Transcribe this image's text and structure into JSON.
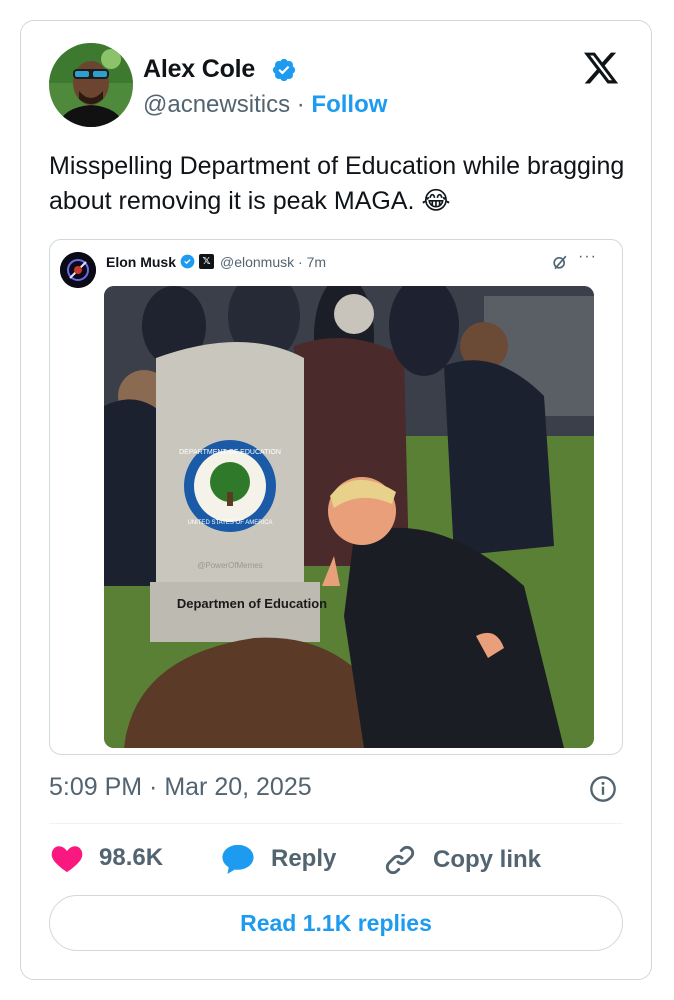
{
  "tweet": {
    "author_name": "Alex Cole",
    "author_handle": "@acnewsitics",
    "separator": "·",
    "follow_label": "Follow",
    "text": "Misspelling Department of Education while bragging about removing it is peak MAGA. 😂",
    "timestamp": "5:09 PM · Mar 20, 2025",
    "likes": "98.6K",
    "reply_label": "Reply",
    "copy_link_label": "Copy link",
    "read_replies_label": "Read 1.1K replies"
  },
  "quoted_tweet": {
    "author_name": "Elon Musk",
    "author_handle": "@elonmusk",
    "time": "· 7m",
    "more": "···",
    "image": {
      "seal_top_text": "DEPARTMENT OF EDUCATION",
      "seal_bottom_text": "UNITED STATES OF AMERICA",
      "watermark": "@PowerOfMemes",
      "headstone_text": "Departmen of Education"
    }
  },
  "colors": {
    "accent": "#1d9bf0",
    "like": "#f91880",
    "muted": "#536471",
    "text": "#0f1419",
    "border": "#cfd9de"
  },
  "icons": {
    "verified": "verified-badge-icon",
    "x_logo": "x-logo-icon",
    "info": "info-icon",
    "like": "heart-icon",
    "reply": "speech-bubble-icon",
    "copy": "link-icon",
    "grok": "grok-icon",
    "more": "more-icon"
  }
}
